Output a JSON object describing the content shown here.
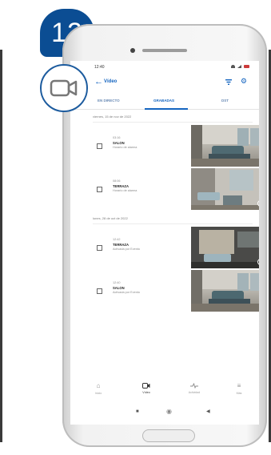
{
  "step": {
    "number": "12"
  },
  "status_bar": {
    "time": "12:40"
  },
  "app_bar": {
    "title": "Vídeo",
    "back_icon": "back-arrow-icon",
    "filter_icon": "filter-icon",
    "settings_icon": "gear-icon"
  },
  "tabs": [
    {
      "label": "EN DIRECTO",
      "active": false
    },
    {
      "label": "GRABADAS",
      "active": true
    },
    {
      "label": "DST",
      "active": false
    }
  ],
  "groups": [
    {
      "date": "viernes, 15 de nov de 2022",
      "items": [
        {
          "time": "03:16",
          "camera": "SALON",
          "reason": "Horario de alarma"
        },
        {
          "time": "08:06",
          "camera": "TERRAZA",
          "reason": "Horario de alarma"
        }
      ]
    },
    {
      "date": "lunes, 28 de oct de 2022",
      "items": [
        {
          "time": "12:42",
          "camera": "TERRAZA",
          "reason": "Activada por Evento"
        },
        {
          "time": "12:40",
          "camera": "SALON",
          "reason": "Activada por Evento"
        }
      ]
    }
  ],
  "bottom_nav": [
    {
      "label": "Inicio",
      "icon": "home-icon",
      "active": false
    },
    {
      "label": "Vídeo",
      "icon": "video-camera-icon",
      "active": true
    },
    {
      "label": "Actividad",
      "icon": "activity-icon",
      "active": false
    },
    {
      "label": "Más",
      "icon": "menu-icon",
      "active": false
    }
  ],
  "colors": {
    "accent": "#1565c0",
    "badge": "#0b4d93",
    "callout_ring": "#1c5b9e"
  }
}
